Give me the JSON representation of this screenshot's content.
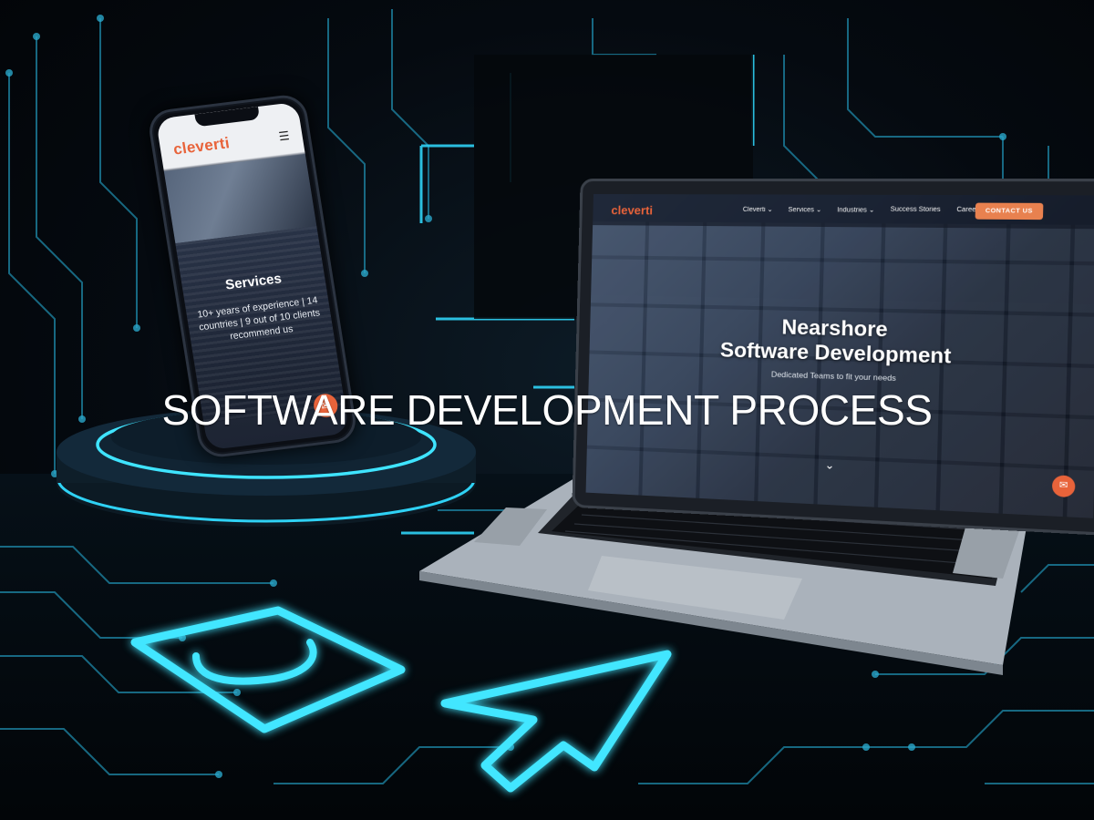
{
  "overlay": {
    "title": "SOFTWARE DEVELOPMENT PROCESS"
  },
  "phone": {
    "logo": "cleverti",
    "menu_icon": "hamburger-icon",
    "hero_title": "Services",
    "hero_subtitle": "10+ years of experience | 14 countries | 9 out of 10 clients recommend us",
    "chat_icon": "chat-icon"
  },
  "laptop": {
    "logo": "cleverti",
    "nav": [
      {
        "label": "Cleverti ⌄"
      },
      {
        "label": "Services ⌄"
      },
      {
        "label": "Industries ⌄"
      },
      {
        "label": "Success Stories"
      },
      {
        "label": "Careers"
      }
    ],
    "cta": "CONTACT US",
    "hero_title_line1": "Nearshore",
    "hero_title_line2": "Software Development",
    "hero_subtitle": "Dedicated Teams to fit your needs",
    "scroll_icon": "chevron-down-icon",
    "chat_icon": "chat-icon"
  },
  "neon_icons": [
    "shopping-bag-icon",
    "cursor-arrow-icon"
  ],
  "colors": {
    "neon": "#3fe4ff",
    "brand": "#e8633a",
    "background": "#04070c"
  }
}
